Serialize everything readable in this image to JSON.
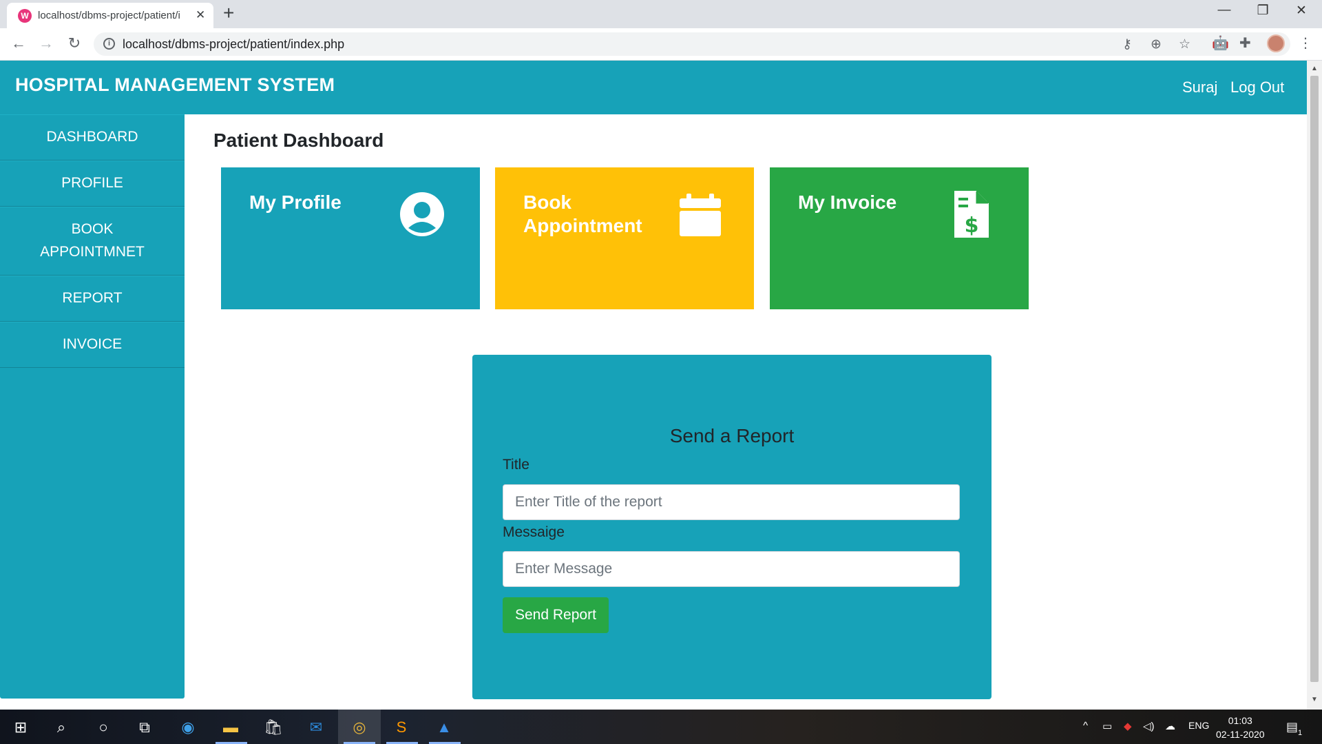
{
  "browser": {
    "tab_title": "localhost/dbms-project/patient/i",
    "tab_favicon_letter": "W",
    "url": "localhost/dbms-project/patient/index.php"
  },
  "navbar": {
    "brand": "HOSPITAL MANAGEMENT SYSTEM",
    "user_name": "Suraj",
    "logout_label": "Log Out"
  },
  "sidebar": {
    "items": [
      {
        "label": "DASHBOARD"
      },
      {
        "label": "PROFILE"
      },
      {
        "label": "BOOK APPOINTMNET"
      },
      {
        "label": "REPORT"
      },
      {
        "label": "INVOICE"
      }
    ]
  },
  "main": {
    "page_title": "Patient Dashboard",
    "cards": [
      {
        "title": "My Profile",
        "color": "#17a2b8",
        "icon": "user-circle-icon"
      },
      {
        "title": "Book Appointment",
        "color": "#ffc107",
        "icon": "calendar-icon"
      },
      {
        "title": "My Invoice",
        "color": "#28a745",
        "icon": "invoice-dollar-icon"
      }
    ]
  },
  "report_form": {
    "heading": "Send a Report",
    "title_label": "Title",
    "title_placeholder": "Enter Title of the report",
    "message_label": "Messaige",
    "message_placeholder": "Enter Message",
    "submit_label": "Send Report"
  },
  "taskbar": {
    "language": "ENG",
    "time": "01:03",
    "date": "02-11-2020",
    "notification_count": "1"
  },
  "colors": {
    "primary": "#17a2b8",
    "warning": "#ffc107",
    "success": "#28a745"
  }
}
